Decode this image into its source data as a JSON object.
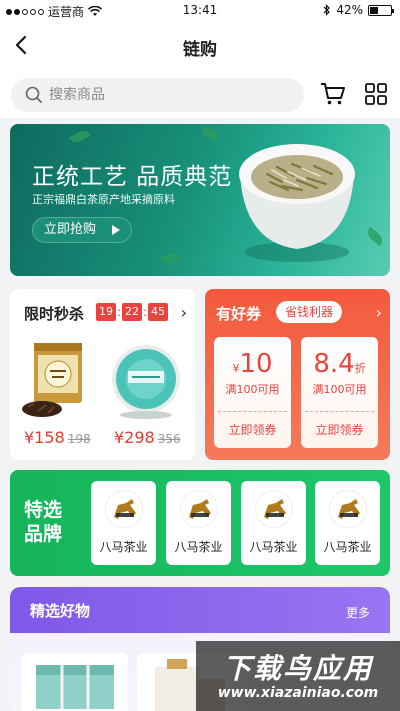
{
  "status_bar": {
    "carrier": "运营商",
    "time": "13:41",
    "battery": "42%"
  },
  "nav": {
    "title": "链购"
  },
  "search": {
    "placeholder": "搜索商品"
  },
  "banner": {
    "headline": "正统工艺 品质典范",
    "subline": "正宗福鼎白茶原产地采摘原料",
    "cta": "立即抢购"
  },
  "flash_sale": {
    "title": "限时秒杀",
    "timer": {
      "h": "19",
      "m": "22",
      "s": "45"
    },
    "products": [
      {
        "price": "¥158",
        "original": "198"
      },
      {
        "price": "¥298",
        "original": "356"
      }
    ]
  },
  "coupons": {
    "title": "有好券",
    "tag": "省钱利器",
    "items": [
      {
        "prefix": "¥",
        "amount": "10",
        "suffix": "",
        "condition": "满100可用",
        "action": "立即领券"
      },
      {
        "prefix": "",
        "amount": "8.4",
        "suffix": "折",
        "condition": "满100可用",
        "action": "立即领券"
      }
    ]
  },
  "brands": {
    "label": "特选品牌",
    "items": [
      {
        "name": "八马茶业"
      },
      {
        "name": "八马茶业"
      },
      {
        "name": "八马茶业"
      },
      {
        "name": "八马茶业"
      }
    ]
  },
  "picks": {
    "title": "精选好物",
    "more": "更多"
  },
  "watermark": {
    "line1": "下载鸟应用",
    "line2": "www.xiazainiao.com"
  },
  "colors": {
    "accent_red": "#e8443f",
    "brand_green": "#1ec76a",
    "banner_teal": "#178f79",
    "pick_purple": "#7f58e8"
  }
}
